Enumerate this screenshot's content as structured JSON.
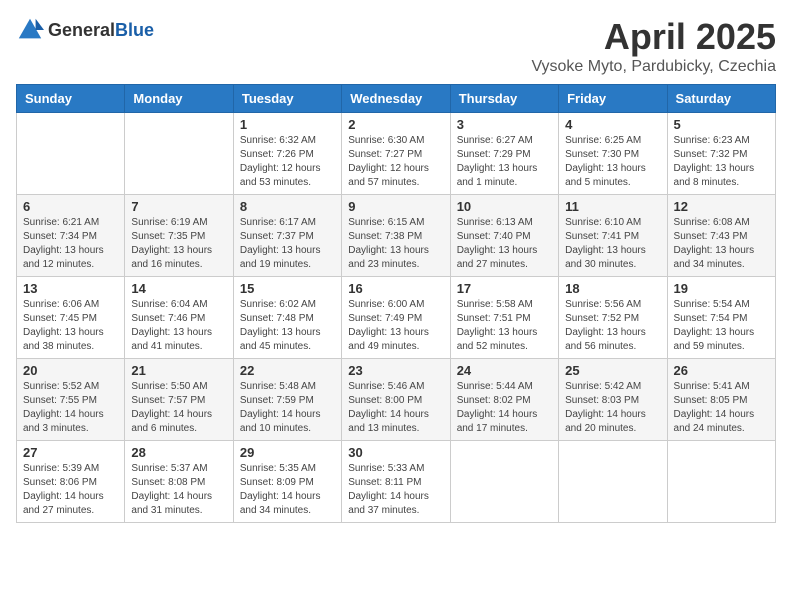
{
  "header": {
    "logo_general": "General",
    "logo_blue": "Blue",
    "month": "April 2025",
    "location": "Vysoke Myto, Pardubicky, Czechia"
  },
  "days_of_week": [
    "Sunday",
    "Monday",
    "Tuesday",
    "Wednesday",
    "Thursday",
    "Friday",
    "Saturday"
  ],
  "weeks": [
    [
      {
        "day": "",
        "info": ""
      },
      {
        "day": "",
        "info": ""
      },
      {
        "day": "1",
        "info": "Sunrise: 6:32 AM\nSunset: 7:26 PM\nDaylight: 12 hours\nand 53 minutes."
      },
      {
        "day": "2",
        "info": "Sunrise: 6:30 AM\nSunset: 7:27 PM\nDaylight: 12 hours\nand 57 minutes."
      },
      {
        "day": "3",
        "info": "Sunrise: 6:27 AM\nSunset: 7:29 PM\nDaylight: 13 hours\nand 1 minute."
      },
      {
        "day": "4",
        "info": "Sunrise: 6:25 AM\nSunset: 7:30 PM\nDaylight: 13 hours\nand 5 minutes."
      },
      {
        "day": "5",
        "info": "Sunrise: 6:23 AM\nSunset: 7:32 PM\nDaylight: 13 hours\nand 8 minutes."
      }
    ],
    [
      {
        "day": "6",
        "info": "Sunrise: 6:21 AM\nSunset: 7:34 PM\nDaylight: 13 hours\nand 12 minutes."
      },
      {
        "day": "7",
        "info": "Sunrise: 6:19 AM\nSunset: 7:35 PM\nDaylight: 13 hours\nand 16 minutes."
      },
      {
        "day": "8",
        "info": "Sunrise: 6:17 AM\nSunset: 7:37 PM\nDaylight: 13 hours\nand 19 minutes."
      },
      {
        "day": "9",
        "info": "Sunrise: 6:15 AM\nSunset: 7:38 PM\nDaylight: 13 hours\nand 23 minutes."
      },
      {
        "day": "10",
        "info": "Sunrise: 6:13 AM\nSunset: 7:40 PM\nDaylight: 13 hours\nand 27 minutes."
      },
      {
        "day": "11",
        "info": "Sunrise: 6:10 AM\nSunset: 7:41 PM\nDaylight: 13 hours\nand 30 minutes."
      },
      {
        "day": "12",
        "info": "Sunrise: 6:08 AM\nSunset: 7:43 PM\nDaylight: 13 hours\nand 34 minutes."
      }
    ],
    [
      {
        "day": "13",
        "info": "Sunrise: 6:06 AM\nSunset: 7:45 PM\nDaylight: 13 hours\nand 38 minutes."
      },
      {
        "day": "14",
        "info": "Sunrise: 6:04 AM\nSunset: 7:46 PM\nDaylight: 13 hours\nand 41 minutes."
      },
      {
        "day": "15",
        "info": "Sunrise: 6:02 AM\nSunset: 7:48 PM\nDaylight: 13 hours\nand 45 minutes."
      },
      {
        "day": "16",
        "info": "Sunrise: 6:00 AM\nSunset: 7:49 PM\nDaylight: 13 hours\nand 49 minutes."
      },
      {
        "day": "17",
        "info": "Sunrise: 5:58 AM\nSunset: 7:51 PM\nDaylight: 13 hours\nand 52 minutes."
      },
      {
        "day": "18",
        "info": "Sunrise: 5:56 AM\nSunset: 7:52 PM\nDaylight: 13 hours\nand 56 minutes."
      },
      {
        "day": "19",
        "info": "Sunrise: 5:54 AM\nSunset: 7:54 PM\nDaylight: 13 hours\nand 59 minutes."
      }
    ],
    [
      {
        "day": "20",
        "info": "Sunrise: 5:52 AM\nSunset: 7:55 PM\nDaylight: 14 hours\nand 3 minutes."
      },
      {
        "day": "21",
        "info": "Sunrise: 5:50 AM\nSunset: 7:57 PM\nDaylight: 14 hours\nand 6 minutes."
      },
      {
        "day": "22",
        "info": "Sunrise: 5:48 AM\nSunset: 7:59 PM\nDaylight: 14 hours\nand 10 minutes."
      },
      {
        "day": "23",
        "info": "Sunrise: 5:46 AM\nSunset: 8:00 PM\nDaylight: 14 hours\nand 13 minutes."
      },
      {
        "day": "24",
        "info": "Sunrise: 5:44 AM\nSunset: 8:02 PM\nDaylight: 14 hours\nand 17 minutes."
      },
      {
        "day": "25",
        "info": "Sunrise: 5:42 AM\nSunset: 8:03 PM\nDaylight: 14 hours\nand 20 minutes."
      },
      {
        "day": "26",
        "info": "Sunrise: 5:41 AM\nSunset: 8:05 PM\nDaylight: 14 hours\nand 24 minutes."
      }
    ],
    [
      {
        "day": "27",
        "info": "Sunrise: 5:39 AM\nSunset: 8:06 PM\nDaylight: 14 hours\nand 27 minutes."
      },
      {
        "day": "28",
        "info": "Sunrise: 5:37 AM\nSunset: 8:08 PM\nDaylight: 14 hours\nand 31 minutes."
      },
      {
        "day": "29",
        "info": "Sunrise: 5:35 AM\nSunset: 8:09 PM\nDaylight: 14 hours\nand 34 minutes."
      },
      {
        "day": "30",
        "info": "Sunrise: 5:33 AM\nSunset: 8:11 PM\nDaylight: 14 hours\nand 37 minutes."
      },
      {
        "day": "",
        "info": ""
      },
      {
        "day": "",
        "info": ""
      },
      {
        "day": "",
        "info": ""
      }
    ]
  ]
}
